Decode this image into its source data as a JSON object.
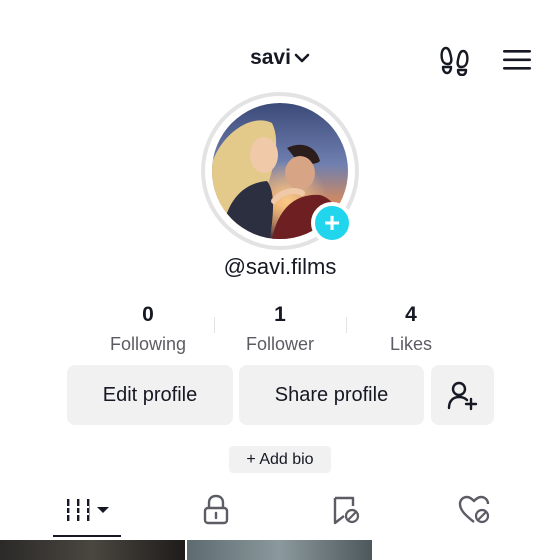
{
  "header": {
    "username": "savi",
    "footprint_icon": "footprints-icon",
    "menu_icon": "hamburger-menu-icon"
  },
  "profile": {
    "handle": "@savi.films",
    "add_avatar_symbol": "+"
  },
  "stats": [
    {
      "value": "0",
      "label": "Following"
    },
    {
      "value": "1",
      "label": "Follower"
    },
    {
      "value": "4",
      "label": "Likes"
    }
  ],
  "actions": {
    "edit_label": "Edit profile",
    "share_label": "Share profile",
    "add_friend_icon": "person-add-icon"
  },
  "bio": {
    "label": "+ Add bio"
  },
  "tabs": [
    {
      "icon": "videos-grid-icon",
      "active": true
    },
    {
      "icon": "lock-icon",
      "active": false
    },
    {
      "icon": "bookmark-icon",
      "active": false
    },
    {
      "icon": "liked-heart-icon",
      "active": false
    }
  ],
  "colors": {
    "accent": "#20d5ec",
    "text": "#161823",
    "muted": "#5c5d64",
    "button_bg": "#f1f1f2"
  }
}
